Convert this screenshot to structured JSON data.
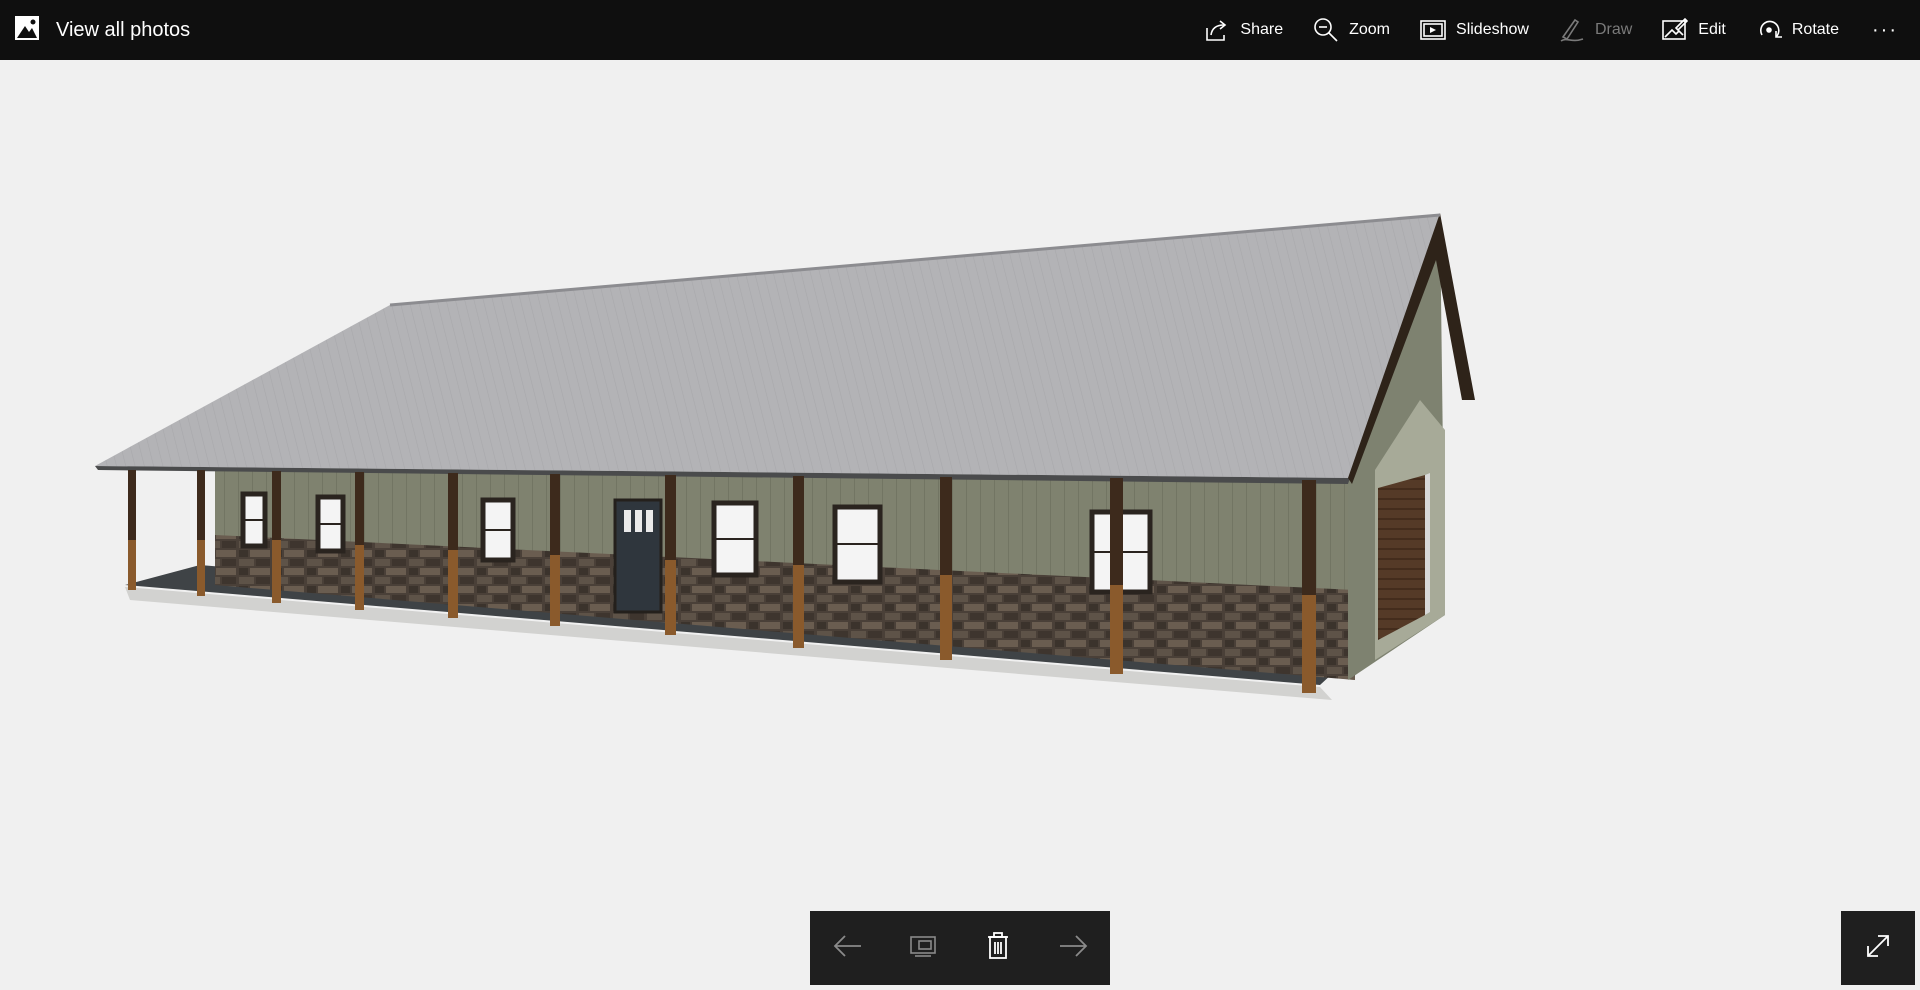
{
  "app": {
    "back_label": "View all photos"
  },
  "toolbar": {
    "share_label": "Share",
    "zoom_label": "Zoom",
    "slideshow_label": "Slideshow",
    "draw_label": "Draw",
    "edit_label": "Edit",
    "rotate_label": "Rotate",
    "more_label": "···"
  },
  "icons": {
    "back": "photos-app-icon",
    "share": "share-icon",
    "zoom": "zoom-icon",
    "slideshow": "slideshow-icon",
    "draw": "pen-icon",
    "edit": "edit-icon",
    "rotate": "rotate-icon",
    "prev": "arrow-left-icon",
    "filmstrip": "filmstrip-icon",
    "delete": "trash-icon",
    "next": "arrow-right-icon",
    "fullscreen": "expand-icon"
  },
  "colors": {
    "toolbar_bg": "#0f0f0f",
    "stage_bg": "#f0f0f0",
    "control_bg": "#1f1f1f",
    "disabled_text": "#7a7a7a"
  }
}
